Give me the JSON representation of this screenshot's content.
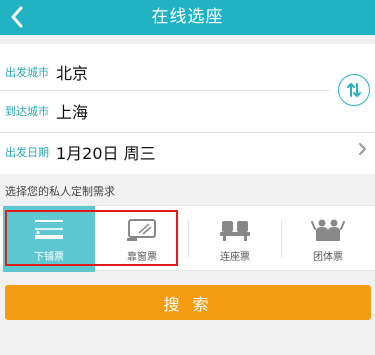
{
  "header": {
    "title": "在线选座",
    "back_icon": "chevron-left-icon"
  },
  "form": {
    "depart": {
      "label": "出发城市",
      "value": "北京"
    },
    "arrive": {
      "label": "到达城市",
      "value": "上海"
    },
    "date": {
      "label": "出发日期",
      "value": "1月20日  周三"
    },
    "swap_icon": "swap-vertical-icon"
  },
  "preferences": {
    "label": "选择您的私人定制需求",
    "options": [
      {
        "label": "下铺票",
        "icon": "lower-berth-icon",
        "selected": true
      },
      {
        "label": "靠窗票",
        "icon": "window-seat-icon",
        "selected": false
      },
      {
        "label": "连座票",
        "icon": "adjacent-seats-icon",
        "selected": false
      },
      {
        "label": "团体票",
        "icon": "group-icon",
        "selected": false
      }
    ]
  },
  "search": {
    "label": "搜 索"
  },
  "colors": {
    "brand": "#21b3c3",
    "active": "#5fc7d2",
    "search": "#f39c12",
    "highlight": "#e21a1a"
  }
}
